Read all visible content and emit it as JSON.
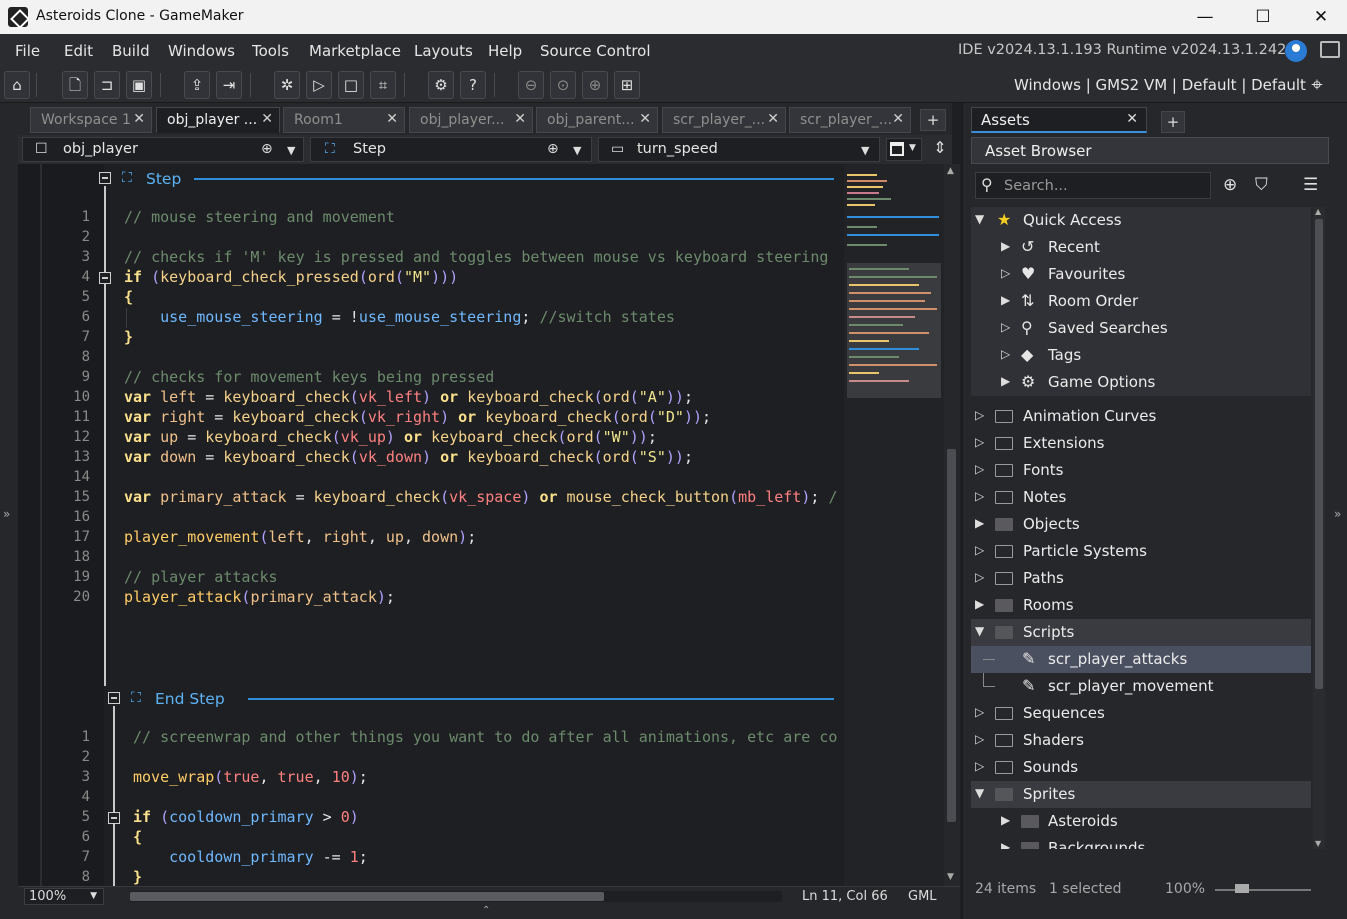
{
  "window": {
    "title": "Asteroids Clone - GameMaker",
    "minimize": "—",
    "maximize": "☐",
    "close": "✕"
  },
  "menu": {
    "items": [
      "File",
      "Edit",
      "Build",
      "Windows",
      "Tools",
      "Marketplace",
      "Layouts",
      "Help",
      "Source Control"
    ],
    "version": "IDE v2024.13.1.193  Runtime v2024.13.1.242"
  },
  "toolbar": {
    "target": "Windows | GMS2 VM | Default | Default"
  },
  "tabs": [
    {
      "label": "Workspace 1",
      "active": false
    },
    {
      "label": "obj_player ...",
      "active": true
    },
    {
      "label": "Room1",
      "active": false
    },
    {
      "label": "obj_player...",
      "active": false
    },
    {
      "label": "obj_parent...",
      "active": false
    },
    {
      "label": "scr_player_...",
      "active": false
    },
    {
      "label": "scr_player_...",
      "active": false
    }
  ],
  "subbar": {
    "object": "obj_player",
    "event": "Step",
    "function": "turn_speed"
  },
  "editor": {
    "step_event": "Step",
    "end_step_event": "End Step",
    "zoom": "100%",
    "position": "Ln 11, Col 66",
    "language": "GML"
  },
  "step_line_numbers": [
    "1",
    "2",
    "3",
    "4",
    "5",
    "6",
    "7",
    "8",
    "9",
    "10",
    "11",
    "12",
    "13",
    "14",
    "15",
    "16",
    "17",
    "18",
    "19",
    "20"
  ],
  "end_step_line_numbers": [
    "1",
    "2",
    "3",
    "4",
    "5",
    "6",
    "7",
    "8"
  ],
  "assets": {
    "tab_label": "Assets",
    "browser_title": "Asset Browser",
    "search_placeholder": "Search...",
    "quick_access": "Quick Access",
    "quick_items": [
      "Recent",
      "Favourites",
      "Room Order",
      "Saved Searches",
      "Tags",
      "Game Options"
    ],
    "folders": [
      "Animation Curves",
      "Extensions",
      "Fonts",
      "Notes",
      "Objects",
      "Particle Systems",
      "Paths",
      "Rooms",
      "Scripts"
    ],
    "scripts": [
      "scr_player_attacks",
      "scr_player_movement"
    ],
    "folders2": [
      "Sequences",
      "Shaders",
      "Sounds",
      "Sprites"
    ],
    "sprite_folders": [
      "Asteroids",
      "Backgrounds"
    ],
    "items_count": "24 items",
    "selected": "1 selected",
    "zoom": "100%"
  },
  "icons": {
    "home": "home-icon",
    "new": "new-file-icon",
    "open": "open-folder-icon",
    "save": "save-icon",
    "create_exe": "create-executable-icon",
    "export": "export-icon",
    "debug": "debug-icon",
    "run": "play-icon",
    "stop": "stop-icon",
    "clean": "clean-icon",
    "settings": "gear-icon",
    "help": "help-icon",
    "zoom_out": "zoom-out-icon",
    "zoom_reset": "zoom-reset-icon",
    "zoom_in": "zoom-in-icon",
    "split": "split-view-icon",
    "target": "target-icon"
  },
  "colors": {
    "accent": "#2f8fdd",
    "event_header": "#5db2f5",
    "comment": "#6d8a6d",
    "keyword": "#fce18c",
    "string": "#f0e68c",
    "number": "#ff8080"
  }
}
